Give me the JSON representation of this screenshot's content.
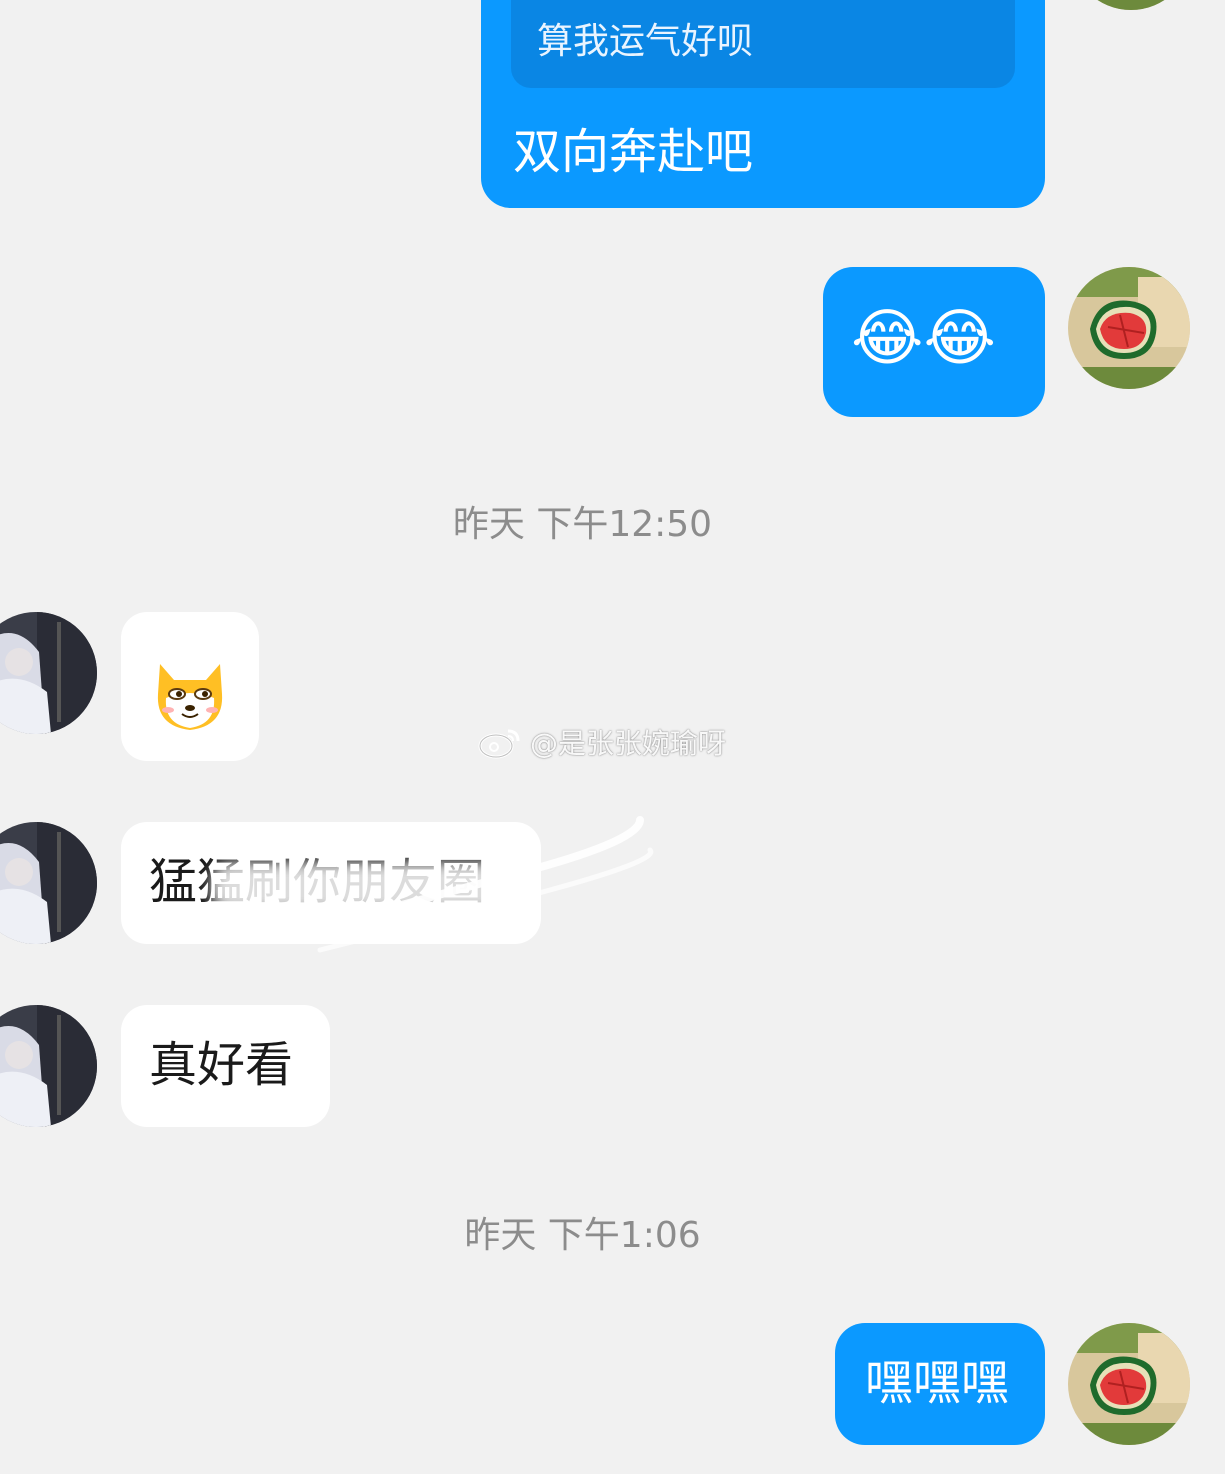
{
  "messages": {
    "quote_text": "算我运气好呗",
    "reply_text": "双向奔赴吧",
    "emoji_message": "😂😂",
    "timestamp_1": "昨天 下午12:50",
    "incoming_text_1": "猛猛刷你朋友圈",
    "incoming_text_2": "真好看",
    "timestamp_2": "昨天 下午1:06",
    "outgoing_text_last": "嘿嘿嘿"
  },
  "watermark": {
    "text": "@是张张婉瑜呀"
  },
  "icons": {
    "self_avatar": "watermelon-avatar",
    "contact_avatar": "anime-character-avatar",
    "sticker": "shiba-dog-sticker",
    "watermark_logo": "weibo-logo-icon"
  },
  "colors": {
    "outgoing_bubble": "#0b99ff",
    "quote_block": "#0a86e4",
    "incoming_bubble": "#ffffff",
    "background": "#f1f1f1",
    "timestamp_text": "#8c8c8c"
  }
}
